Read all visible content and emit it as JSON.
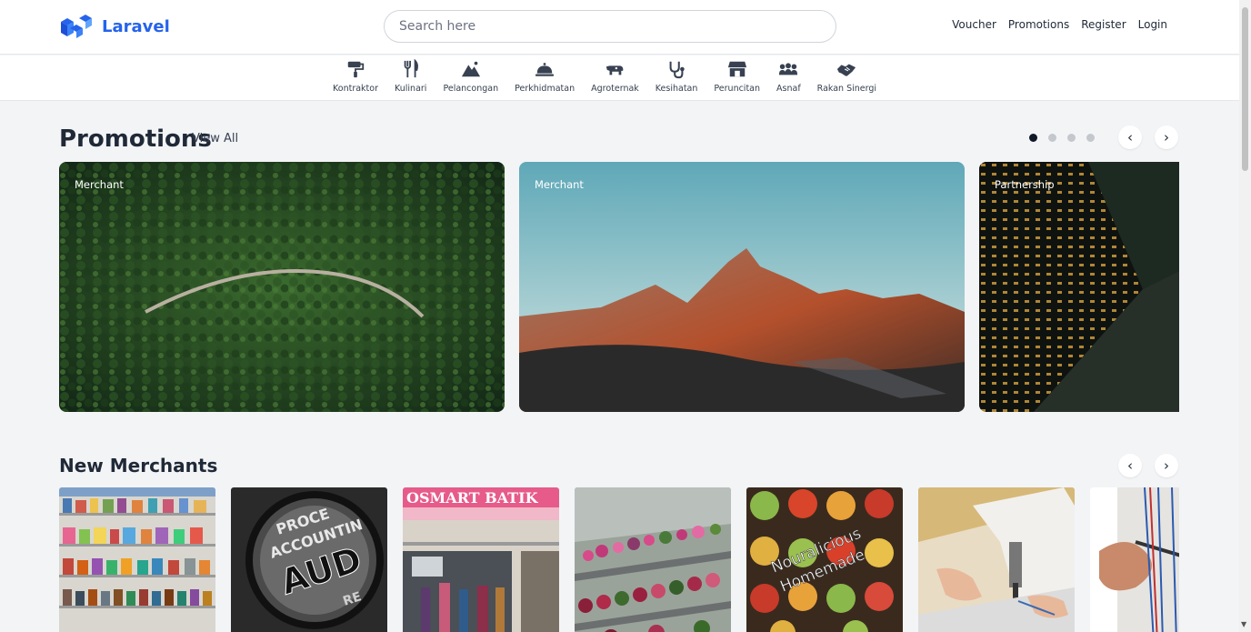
{
  "brand": {
    "name": "Laravel",
    "logo_icon": "laravel-logo-icon"
  },
  "search": {
    "placeholder": "Search here"
  },
  "nav": {
    "voucher": "Voucher",
    "promotions": "Promotions",
    "register": "Register",
    "login": "Login"
  },
  "categories": [
    {
      "label": "Kontraktor",
      "icon": "paint-roller-icon"
    },
    {
      "label": "Kulinari",
      "icon": "utensils-icon"
    },
    {
      "label": "Pelancongan",
      "icon": "mountain-icon"
    },
    {
      "label": "Perkhidmatan",
      "icon": "service-bell-icon"
    },
    {
      "label": "Agroternak",
      "icon": "cow-icon"
    },
    {
      "label": "Kesihatan",
      "icon": "stethoscope-icon"
    },
    {
      "label": "Peruncitan",
      "icon": "store-icon"
    },
    {
      "label": "Asnaf",
      "icon": "people-icon"
    },
    {
      "label": "Rakan Sinergi",
      "icon": "handshake-icon"
    }
  ],
  "promotions": {
    "title": "Promotions",
    "view_all": "View All",
    "slide_count": 4,
    "active_slide": 1,
    "cards": [
      {
        "tag": "Merchant",
        "image": "aerial forest road"
      },
      {
        "tag": "Merchant",
        "image": "mountain at sunset"
      },
      {
        "tag": "Partnership",
        "image": "city buildings at night"
      }
    ]
  },
  "new_merchants": {
    "title": "New Merchants",
    "items": [
      {
        "image": "grocery shelves"
      },
      {
        "image": "accounting audit magnifier",
        "text_lines": [
          "PROCE",
          "ACCOUNTIN",
          "AUD",
          "RE"
        ]
      },
      {
        "image": "batik shop front",
        "sign": "OSMART BATIK"
      },
      {
        "image": "flower nursery"
      },
      {
        "image": "homemade cakes",
        "text_lines": [
          "Nouralicious",
          "Homemade"
        ]
      },
      {
        "image": "sewing machine"
      },
      {
        "image": "electrician wiring"
      }
    ]
  },
  "colors": {
    "brand": "#2563eb",
    "background": "#f3f4f6",
    "header": "#ffffff"
  }
}
